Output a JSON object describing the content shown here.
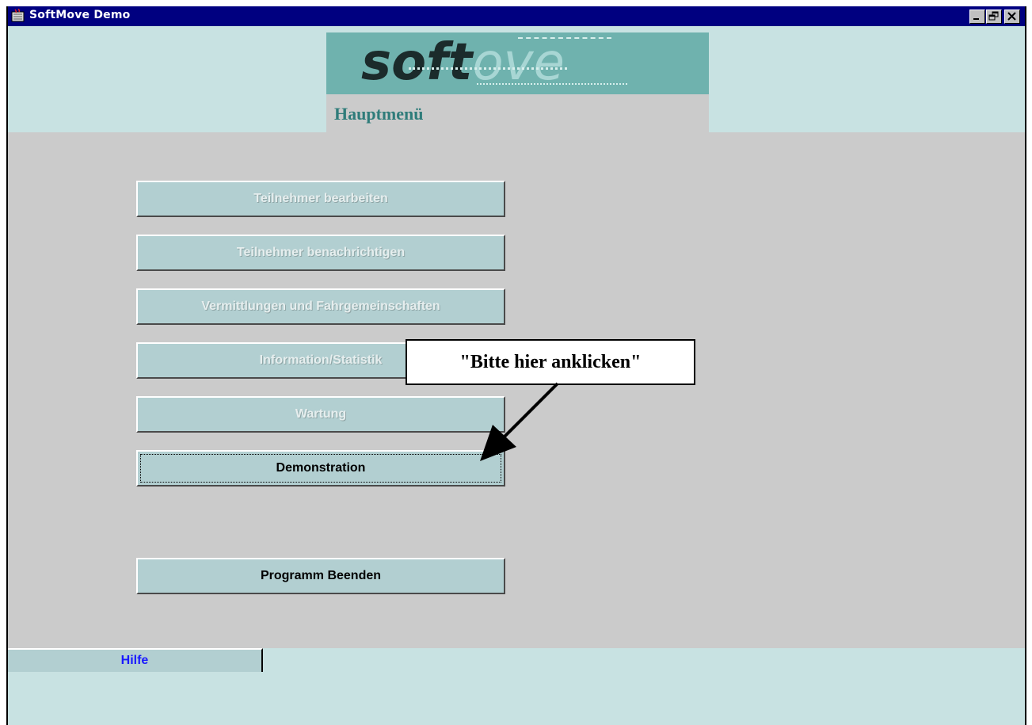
{
  "window": {
    "title": "SoftMove Demo",
    "controls": [
      "minimize-icon",
      "restore-icon",
      "close-icon"
    ]
  },
  "header": {
    "logo_text_bold": "so",
    "logo_text_light": "ft",
    "logo_text_tail": "ove",
    "subtitle": "Hauptmenü"
  },
  "menu": {
    "items": [
      {
        "label": "Teilnehmer bearbeiten",
        "enabled": false
      },
      {
        "label": "Teilnehmer benachrichtigen",
        "enabled": false
      },
      {
        "label": "Vermittlungen und Fahrgemeinschaften",
        "enabled": false
      },
      {
        "label": "Information/Statistik",
        "enabled": false
      },
      {
        "label": "Wartung",
        "enabled": false
      },
      {
        "label": "Demonstration",
        "enabled": true,
        "focused": true
      }
    ],
    "exit_label": "Programm Beenden"
  },
  "callout": {
    "text": "\"Bitte hier anklicken\""
  },
  "footer": {
    "help_label": "Hilfe"
  },
  "colors": {
    "titlebar": "#000080",
    "header_band": "#c8e2e2",
    "button_face": "#b2cfd1",
    "logo_bg": "#6fb2ae",
    "subtitle": "#2f7c7a",
    "help_text": "#1a1aff"
  }
}
